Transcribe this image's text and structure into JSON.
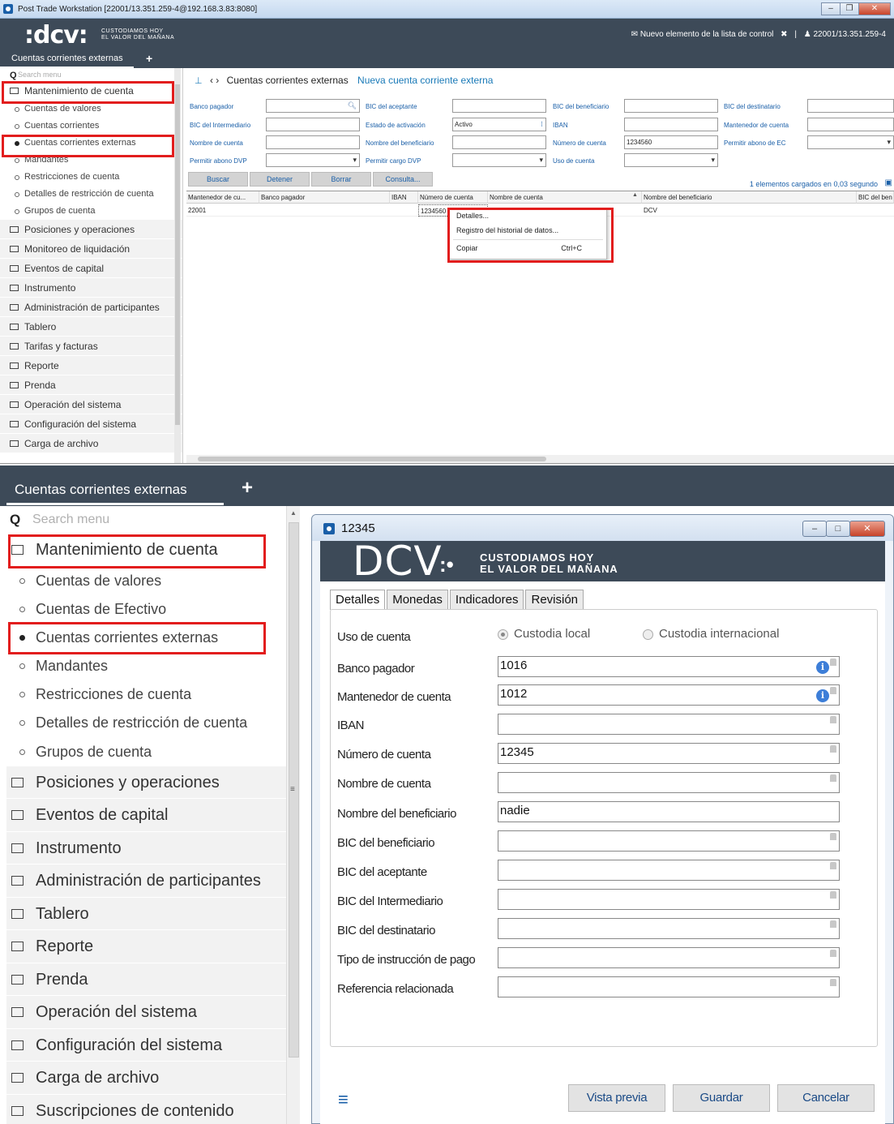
{
  "top": {
    "window_title": "Post Trade Workstation [22001/13.351.259-4@192.168.3.83:8080]",
    "window_buttons": [
      "–",
      "❐",
      "✕"
    ],
    "logo_text": ":dcv:",
    "logo_tagline_1": "CUSTODIAMOS HOY",
    "logo_tagline_2": "EL VALOR DEL MAÑANA",
    "watchlist_text": "Nuevo elemento de la lista de control",
    "watchlist_close": "✖",
    "separator": "|",
    "user_text": "22001/13.351.259-4",
    "tab_label": "Cuentas corrientes externas",
    "tab_add": "+",
    "search_placeholder": "Search menu",
    "menu_open_category": "Mantenimiento de cuenta",
    "menu_sub_items": [
      "Cuentas de valores",
      "Cuentas corrientes",
      "Cuentas corrientes externas",
      "Mandantes",
      "Restricciones de cuenta",
      "Detalles de restricción de cuenta",
      "Grupos de cuenta"
    ],
    "menu_categories": [
      "Posiciones y operaciones",
      "Monitoreo de liquidación",
      "Eventos de capital",
      "Instrumento",
      "Administración de participantes",
      "Tablero",
      "Tarifas y facturas",
      "Reporte",
      "Prenda",
      "Operación del sistema",
      "Configuración del sistema",
      "Carga de archivo"
    ],
    "breadcrumb_current": "Cuentas corrientes externas",
    "breadcrumb_link": "Nueva cuenta corriente externa",
    "filters": {
      "banco_pagador": "Banco pagador",
      "bic_aceptante": "BIC del aceptante",
      "bic_beneficiario": "BIC del beneficiario",
      "bic_destinatario": "BIC del destinatario",
      "bic_intermediario": "BIC del Intermediario",
      "estado_activacion": "Estado de activación",
      "estado_activacion_value": "Activo",
      "iban": "IBAN",
      "mantenedor": "Mantenedor de cuenta",
      "nombre_cuenta": "Nombre de cuenta",
      "nombre_beneficiario": "Nombre del beneficiario",
      "numero_cuenta": "Número de cuenta",
      "numero_cuenta_value": "1234560",
      "permitir_abono_ec": "Permitir abono de EC",
      "permitir_abono_dvp": "Permitir abono DVP",
      "permitir_cargo_dvp": "Permitir cargo DVP",
      "uso_cuenta": "Uso de cuenta"
    },
    "buttons": [
      "Buscar",
      "Detener",
      "Borrar",
      "Consulta..."
    ],
    "loaded_text": "1 elementos cargados en 0,03 segundo",
    "grid_headers": [
      "Mantenedor de cu...",
      "Banco pagador",
      "IBAN",
      "Número de cuenta",
      "Nombre de cuenta",
      "Nombre del beneficiario",
      "BIC del ben"
    ],
    "grid_row": [
      "22001",
      "",
      "",
      "1234560",
      "",
      "DCV",
      ""
    ],
    "context_menu": [
      {
        "label": "Detalles...",
        "shortcut": ""
      },
      {
        "label": "Registro del historial de datos...",
        "shortcut": ""
      },
      {
        "label": "Copiar",
        "shortcut": "Ctrl+C"
      }
    ]
  },
  "bottom": {
    "tab_label": "Cuentas corrientes externas",
    "tab_add": "+",
    "search_placeholder": "Search menu",
    "menu_open_category": "Mantenimiento de cuenta",
    "menu_sub_items": [
      "Cuentas de valores",
      "Cuentas de Efectivo",
      "Cuentas corrientes externas",
      "Mandantes",
      "Restricciones de cuenta",
      "Detalles de restricción de cuenta",
      "Grupos de cuenta"
    ],
    "menu_categories": [
      "Posiciones y operaciones",
      "Eventos de capital",
      "Instrumento",
      "Administración de participantes",
      "Tablero",
      "Reporte",
      "Prenda",
      "Operación del sistema",
      "Configuración del sistema",
      "Carga de archivo",
      "Suscripciones de contenido"
    ],
    "dialog": {
      "title": "12345",
      "window_buttons": [
        "–",
        "□",
        "✕"
      ],
      "logo_text": "DCV",
      "logo_tagline_1": "CUSTODIAMOS HOY",
      "logo_tagline_2": "EL VALOR DEL MAÑANA",
      "tabs": [
        "Detalles",
        "Monedas",
        "Indicadores",
        "Revisión"
      ],
      "uso_cuenta_label": "Uso de cuenta",
      "radio_options": [
        "Custodia local",
        "Custodia internacional"
      ],
      "fields": [
        {
          "label": "Banco pagador",
          "value": "1016"
        },
        {
          "label": "Mantenedor de cuenta",
          "value": "1012"
        },
        {
          "label": "IBAN",
          "value": ""
        },
        {
          "label": "Número de cuenta",
          "value": "12345"
        },
        {
          "label": "Nombre de cuenta",
          "value": ""
        },
        {
          "label": "Nombre del beneficiario",
          "value": "nadie"
        },
        {
          "label": "BIC del beneficiario",
          "value": ""
        },
        {
          "label": "BIC del aceptante",
          "value": ""
        },
        {
          "label": "BIC del Intermediario",
          "value": ""
        },
        {
          "label": "BIC del destinatario",
          "value": ""
        },
        {
          "label": "Tipo de instrucción de pago",
          "value": ""
        },
        {
          "label": "Referencia relacionada",
          "value": ""
        }
      ],
      "menu_icon": "≡",
      "footer_buttons": [
        "Vista previa",
        "Guardar",
        "Cancelar"
      ]
    }
  },
  "colors": {
    "highlight": "#e21d1d",
    "header_bg": "#3d4a58",
    "link": "#1a7ab8",
    "label": "#1a5fa8"
  }
}
